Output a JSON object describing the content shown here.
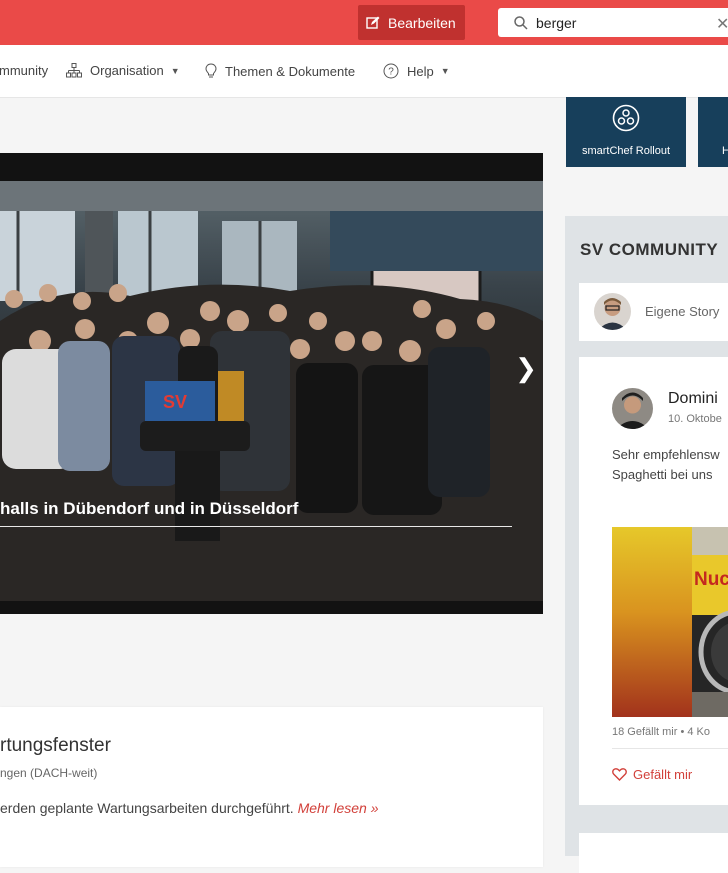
{
  "topbar": {
    "edit_label": "Bearbeiten",
    "search_value": "berger"
  },
  "nav": {
    "community": "mmunity",
    "organisation": "Organisation",
    "themen": "Themen & Dokumente",
    "help": "Help"
  },
  "tiles": [
    {
      "label": "smartChef Rollout"
    },
    {
      "label": "H"
    }
  ],
  "hero": {
    "headline": "halls in Dübendorf und in Düsseldorf",
    "logo_text": "SV"
  },
  "news": {
    "title": "rtungsfenster",
    "subtitle": "ngen (DACH-weit)",
    "text": "erden geplante Wartungsarbeiten durchgeführt.",
    "more": "Mehr lesen »"
  },
  "community": {
    "title": "SV COMMUNITY",
    "story_placeholder": "Eigene Story",
    "post": {
      "author": "Domini",
      "date": "10. Oktobe",
      "line1": "Sehr empfehlensw",
      "line2": "Spaghetti bei uns",
      "image_text": "Nuc",
      "stats": "18 Gefällt mir  •  4 Ko",
      "like": "Gefällt mir"
    }
  },
  "colors": {
    "brand_red": "#ea4a48",
    "button_dark_red": "#c0312f",
    "tile_navy": "#173f5b",
    "link_red": "#d2403a"
  }
}
